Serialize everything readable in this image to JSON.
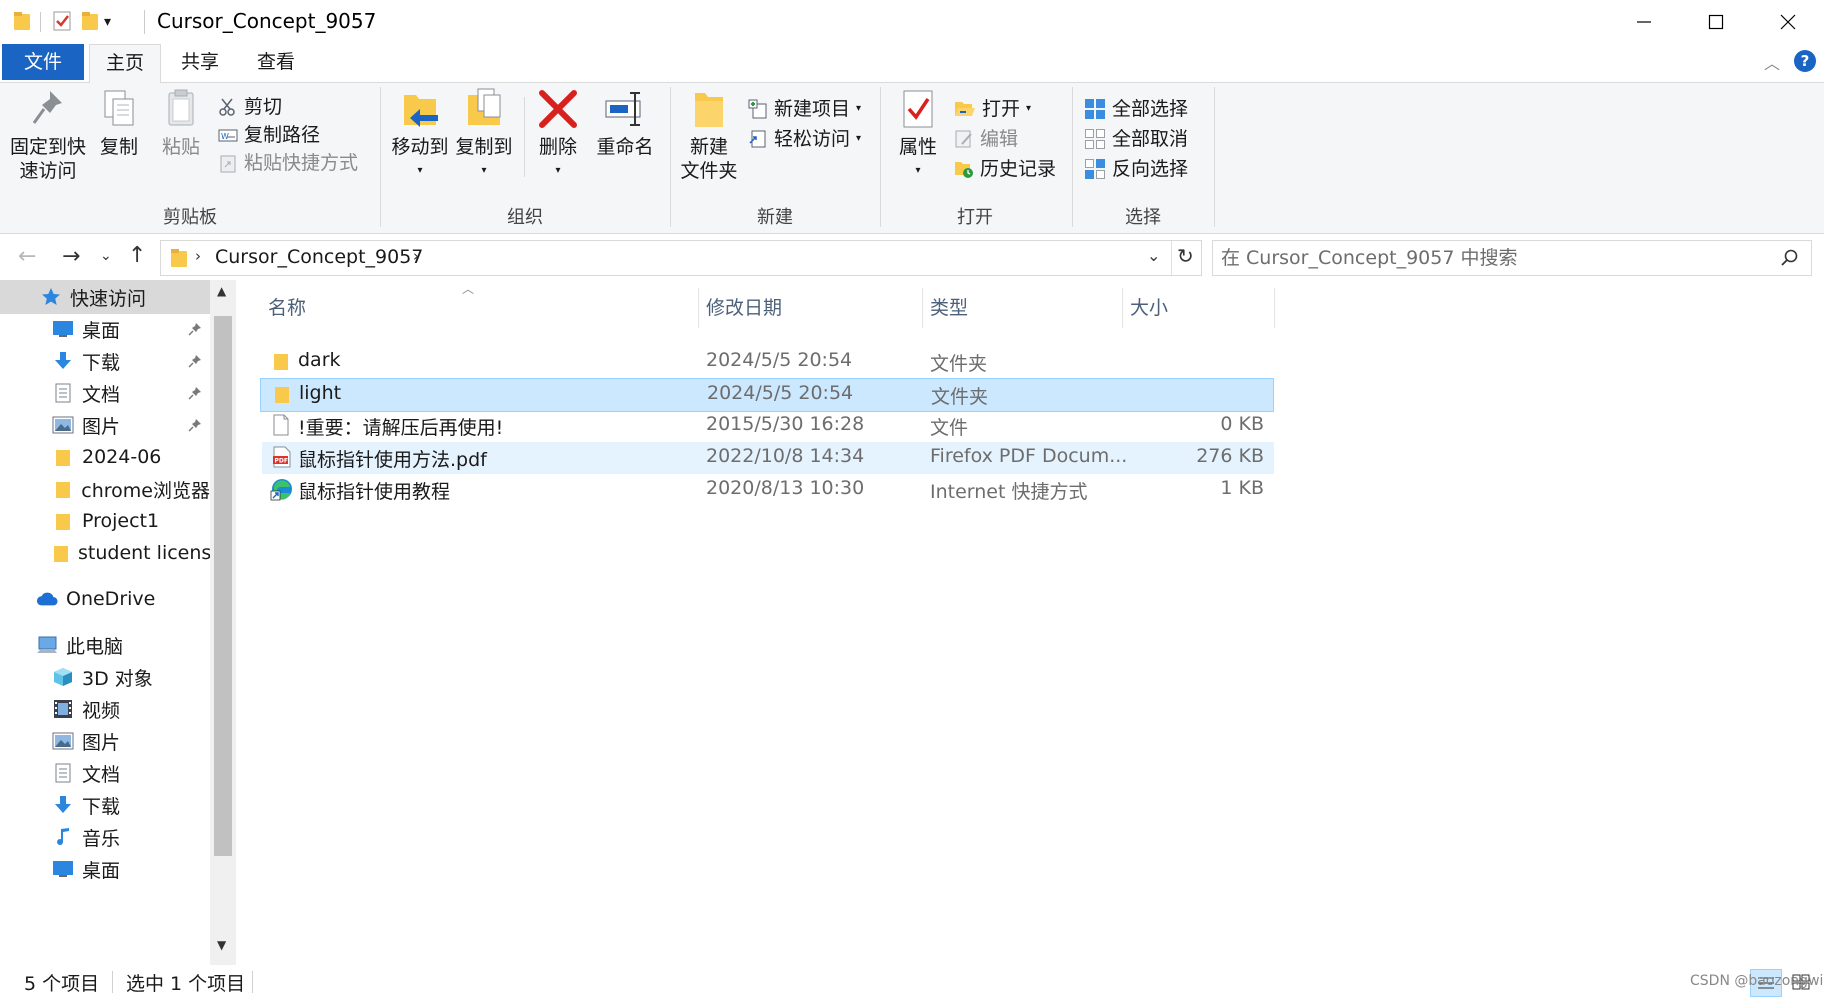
{
  "window": {
    "title": "Cursor_Concept_9057"
  },
  "menu_tabs": {
    "file": "文件",
    "home": "主页",
    "share": "共享",
    "view": "查看"
  },
  "ribbon": {
    "clipboard": {
      "label": "剪贴板",
      "pin": "固定到快\n速访问",
      "pin_l1": "固定到快",
      "pin_l2": "速访问",
      "copy": "复制",
      "paste": "粘贴",
      "cut": "剪切",
      "copy_path": "复制路径",
      "paste_shortcut": "粘贴快捷方式"
    },
    "organize": {
      "label": "组织",
      "move_to": "移动到",
      "copy_to": "复制到",
      "delete": "删除",
      "rename": "重命名"
    },
    "new": {
      "label": "新建",
      "new_folder_l1": "新建",
      "new_folder_l2": "文件夹",
      "new_item": "新建项目",
      "easy_access": "轻松访问"
    },
    "open": {
      "label": "打开",
      "properties": "属性",
      "open": "打开",
      "edit": "编辑",
      "history": "历史记录"
    },
    "select": {
      "label": "选择",
      "select_all": "全部选择",
      "select_none": "全部取消",
      "invert": "反向选择"
    }
  },
  "address": {
    "path": "Cursor_Concept_9057",
    "search_placeholder": "在 Cursor_Concept_9057 中搜索"
  },
  "nav_pane": {
    "quick_access": "快速访问",
    "quick_items": [
      {
        "label": "桌面",
        "pinned": true
      },
      {
        "label": "下载",
        "pinned": true
      },
      {
        "label": "文档",
        "pinned": true
      },
      {
        "label": "图片",
        "pinned": true
      },
      {
        "label": "2024-06",
        "pinned": false
      },
      {
        "label": "chrome浏览器",
        "pinned": false
      },
      {
        "label": "Project1",
        "pinned": false
      },
      {
        "label": "student license",
        "pinned": false
      }
    ],
    "onedrive": "OneDrive",
    "this_pc": "此电脑",
    "pc_items": [
      {
        "label": "3D 对象"
      },
      {
        "label": "视频"
      },
      {
        "label": "图片"
      },
      {
        "label": "文档"
      },
      {
        "label": "下载"
      },
      {
        "label": "音乐"
      },
      {
        "label": "桌面"
      }
    ]
  },
  "file_list": {
    "columns": {
      "name": "名称",
      "date": "修改日期",
      "type": "类型",
      "size": "大小"
    },
    "rows": [
      {
        "name": "dark",
        "date": "2024/5/5 20:54",
        "type": "文件夹",
        "size": "",
        "icon": "folder-icon"
      },
      {
        "name": "light",
        "date": "2024/5/5 20:54",
        "type": "文件夹",
        "size": "",
        "icon": "folder-icon"
      },
      {
        "name": "!重要：请解压后再使用!",
        "date": "2015/5/30 16:28",
        "type": "文件",
        "size": "0 KB",
        "icon": "file-icon"
      },
      {
        "name": "鼠标指针使用方法.pdf",
        "date": "2022/10/8 14:34",
        "type": "Firefox PDF Docum...",
        "size": "276 KB",
        "icon": "pdf-icon"
      },
      {
        "name": "鼠标指针使用教程",
        "date": "2020/8/13 10:30",
        "type": "Internet 快捷方式",
        "size": "1 KB",
        "icon": "edge-shortcut-icon"
      }
    ]
  },
  "status": {
    "item_count": "5 个项目",
    "selected": "选中 1 个项目"
  },
  "watermark": "CSDN @baozongwi",
  "colors": {
    "accent": "#1a64c4",
    "selection": "#cce8ff",
    "folder": "#f8c94b"
  }
}
